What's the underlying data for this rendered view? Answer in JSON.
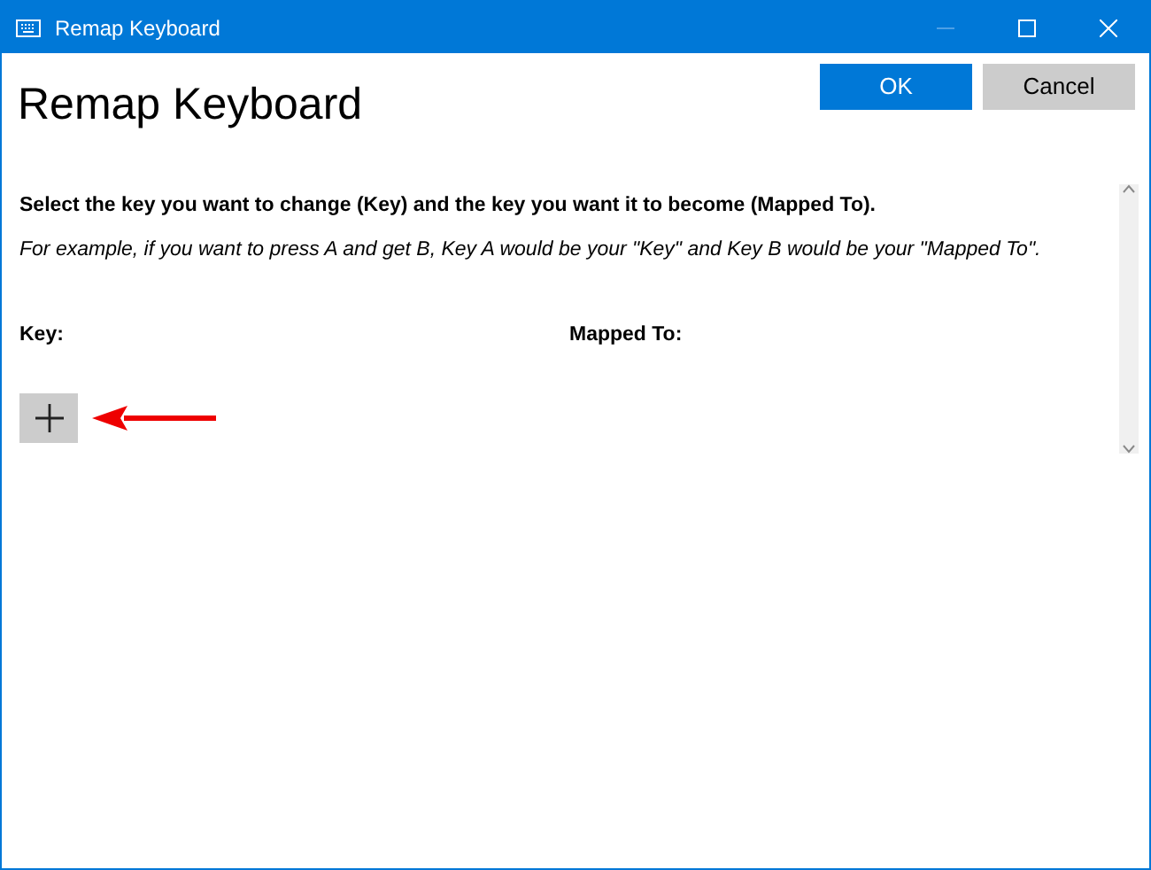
{
  "window": {
    "title": "Remap Keyboard",
    "controls": [
      {
        "kind": "minimize",
        "disabled": true
      },
      {
        "kind": "maximize",
        "disabled": false
      },
      {
        "kind": "close",
        "disabled": false
      }
    ]
  },
  "heading": "Remap Keyboard",
  "buttons": [
    {
      "label": "OK",
      "kind": "primary"
    },
    {
      "label": "Cancel",
      "kind": "secondary"
    }
  ],
  "instructions": "Select the key you want to change (Key) and the key you want it to become (Mapped To).",
  "example": "For example, if you want to press A and get B, Key A would be your \"Key\" and Key B would be your \"Mapped To\".",
  "columns": [
    "Key:",
    "Mapped To:"
  ],
  "annotation": {
    "kind": "arrow"
  }
}
